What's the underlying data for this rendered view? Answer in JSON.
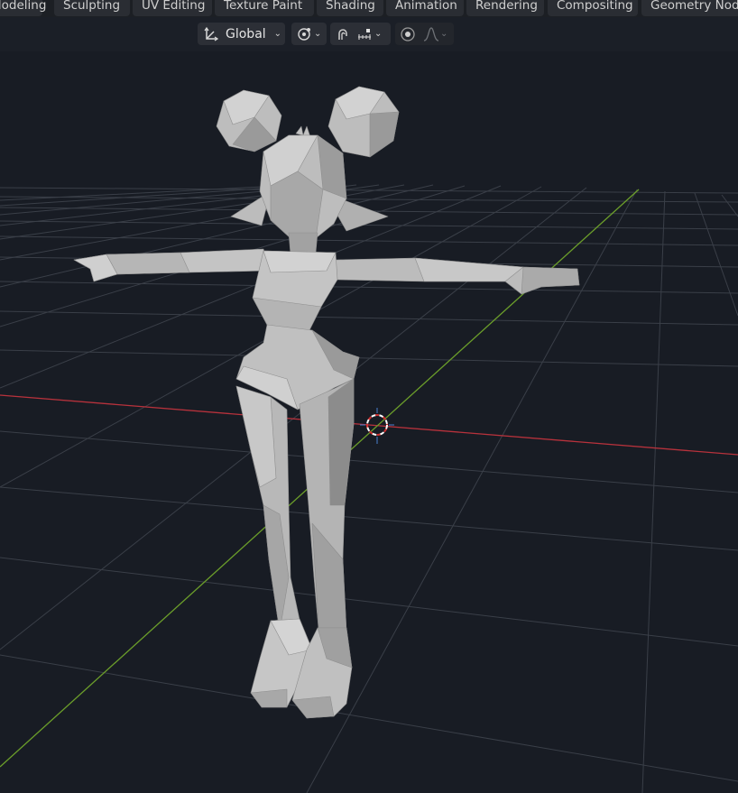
{
  "workspace_tabs": [
    "Modeling",
    "Sculpting",
    "UV Editing",
    "Texture Paint",
    "Shading",
    "Animation",
    "Rendering",
    "Compositing",
    "Geometry Nodes"
  ],
  "header": {
    "transform_orientation": "Global",
    "icons": {
      "orientation": "transform-orientation-icon",
      "pivot": "pivot-point-icon",
      "snap": "magnet-snap-icon",
      "snap_target": "snap-increment-icon",
      "proportional": "proportional-editing-icon",
      "falloff": "falloff-curve-icon"
    }
  },
  "viewport": {
    "object": "low-poly female character in T-pose",
    "colors": {
      "background": "#181c24",
      "grid": "#3a3f48",
      "x_axis": "#b8323c",
      "y_axis": "#6b9e2a",
      "mesh_light": "#c6c6c6",
      "mesh_mid": "#a6a6a6",
      "mesh_dark": "#7e7e7e"
    }
  }
}
